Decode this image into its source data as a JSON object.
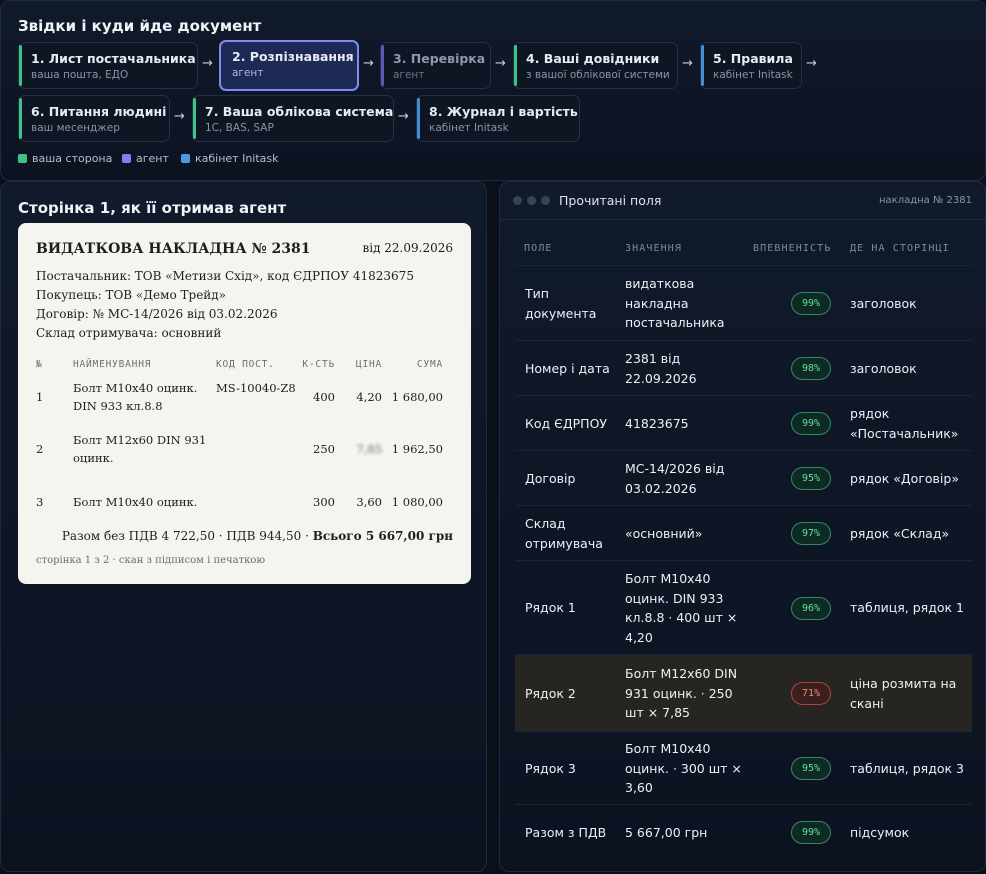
{
  "pipeline": {
    "title": "Звідки і куди йде документ",
    "steps": [
      {
        "title": "1. Лист постачальника",
        "sub": "ваша пошта, ЕДО",
        "kind": "your-side",
        "color": "#3fc187"
      },
      {
        "title": "2. Розпізнавання",
        "sub": "агент",
        "kind": "agent",
        "color": "#7f8cf2",
        "active": true
      },
      {
        "title": "3. Перевірка",
        "sub": "агент",
        "kind": "agent",
        "color": "#5e58b8"
      },
      {
        "title": "4. Ваші довідники",
        "sub": "з вашої облікової системи",
        "kind": "your-side",
        "color": "#3fc187"
      },
      {
        "title": "5. Правила",
        "sub": "кабінет Initask",
        "kind": "cabinet",
        "color": "#3e8fd6"
      },
      {
        "title": "6. Питання людині",
        "sub": "ваш месенджер",
        "kind": "your-side",
        "color": "#3fc187"
      },
      {
        "title": "7. Ваша облікова система",
        "sub": "1С, BAS, SAP",
        "kind": "your-side",
        "color": "#3fc187"
      },
      {
        "title": "8. Журнал і вартість",
        "sub": "кабінет Initask",
        "kind": "cabinet",
        "color": "#3e8fd6"
      }
    ],
    "arrow": "→",
    "legend": [
      {
        "label": "ваша сторона",
        "color": "#3fc187"
      },
      {
        "label": "агент",
        "color": "#7f7ff0"
      },
      {
        "label": "кабінет Initask",
        "color": "#4a9be0"
      }
    ]
  },
  "scan": {
    "heading": "Сторінка 1, як її отримав агент",
    "doc_title": "ВИДАТКОВА НАКЛАДНА № 2381",
    "date": "від 22.09.2026",
    "meta": [
      "Постачальник: ТОВ «Метизи Схід», код ЄДРПОУ 41823675",
      "Покупець: ТОВ «Демо Трейд»",
      "Договір: № МС-14/2026 від 03.02.2026",
      "Склад отримувача: основний"
    ],
    "columns": [
      "№",
      "НАЙМЕНУВАННЯ",
      "КОД ПОСТ.",
      "К-СТЬ",
      "ЦІНА",
      "СУМА"
    ],
    "rows": [
      {
        "n": "1",
        "name": "Болт М10х40 оцинк. DIN 933 кл.8.8",
        "code": "MS-10040-Z8",
        "qty": "400",
        "price": "4,20",
        "sum": "1 680,00",
        "blurred": false
      },
      {
        "n": "2",
        "name": "Болт М12х60 DIN 931 оцинк.",
        "code": "",
        "qty": "250",
        "price": "7,85",
        "sum": "1 962,50",
        "blurred": true
      },
      {
        "n": "3",
        "name": "Болт М10х40 оцинк.",
        "code": "",
        "qty": "300",
        "price": "3,60",
        "sum": "1 080,00",
        "blurred": false
      }
    ],
    "totals_prefix": "Разом без ПДВ 4 722,50 · ПДВ 944,50 · ",
    "totals_bold": "Всього 5 667,00 грн",
    "footer": "сторінка 1 з 2 · скан з підписом і печаткою"
  },
  "fields": {
    "window_title": "Прочитані поля",
    "doc_ref": "накладна № 2381",
    "columns": [
      "ПОЛЕ",
      "ЗНАЧЕННЯ",
      "ВПЕВНЕНІСТЬ",
      "ДЕ НА СТОРІНЦІ"
    ],
    "rows": [
      {
        "field": "Тип документа",
        "value": "видаткова накладна постачальника",
        "confidence": "99%",
        "location": "заголовок",
        "low": false
      },
      {
        "field": "Номер і дата",
        "value": "2381 від 22.09.2026",
        "confidence": "98%",
        "location": "заголовок",
        "low": false
      },
      {
        "field": "Код ЄДРПОУ",
        "value": "41823675",
        "confidence": "99%",
        "location": "рядок «Постачальник»",
        "low": false
      },
      {
        "field": "Договір",
        "value": "МС-14/2026 від 03.02.2026",
        "confidence": "95%",
        "location": "рядок «Договір»",
        "low": false
      },
      {
        "field": "Склад отримувача",
        "value": "«основний»",
        "confidence": "97%",
        "location": "рядок «Склад»",
        "low": false
      },
      {
        "field": "Рядок 1",
        "value": "Болт М10х40 оцинк. DIN 933 кл.8.8 · 400 шт × 4,20",
        "confidence": "96%",
        "location": "таблиця, рядок 1",
        "low": false
      },
      {
        "field": "Рядок 2",
        "value": "Болт М12х60 DIN 931 оцинк. · 250 шт × 7,85",
        "confidence": "71%",
        "location": "ціна розмита на скані",
        "low": true
      },
      {
        "field": "Рядок 3",
        "value": "Болт М10х40 оцинк. · 300 шт × 3,60",
        "confidence": "95%",
        "location": "таблиця, рядок 3",
        "low": false
      },
      {
        "field": "Разом з ПДВ",
        "value": "5 667,00 грн",
        "confidence": "99%",
        "location": "підсумок",
        "low": false
      }
    ]
  }
}
